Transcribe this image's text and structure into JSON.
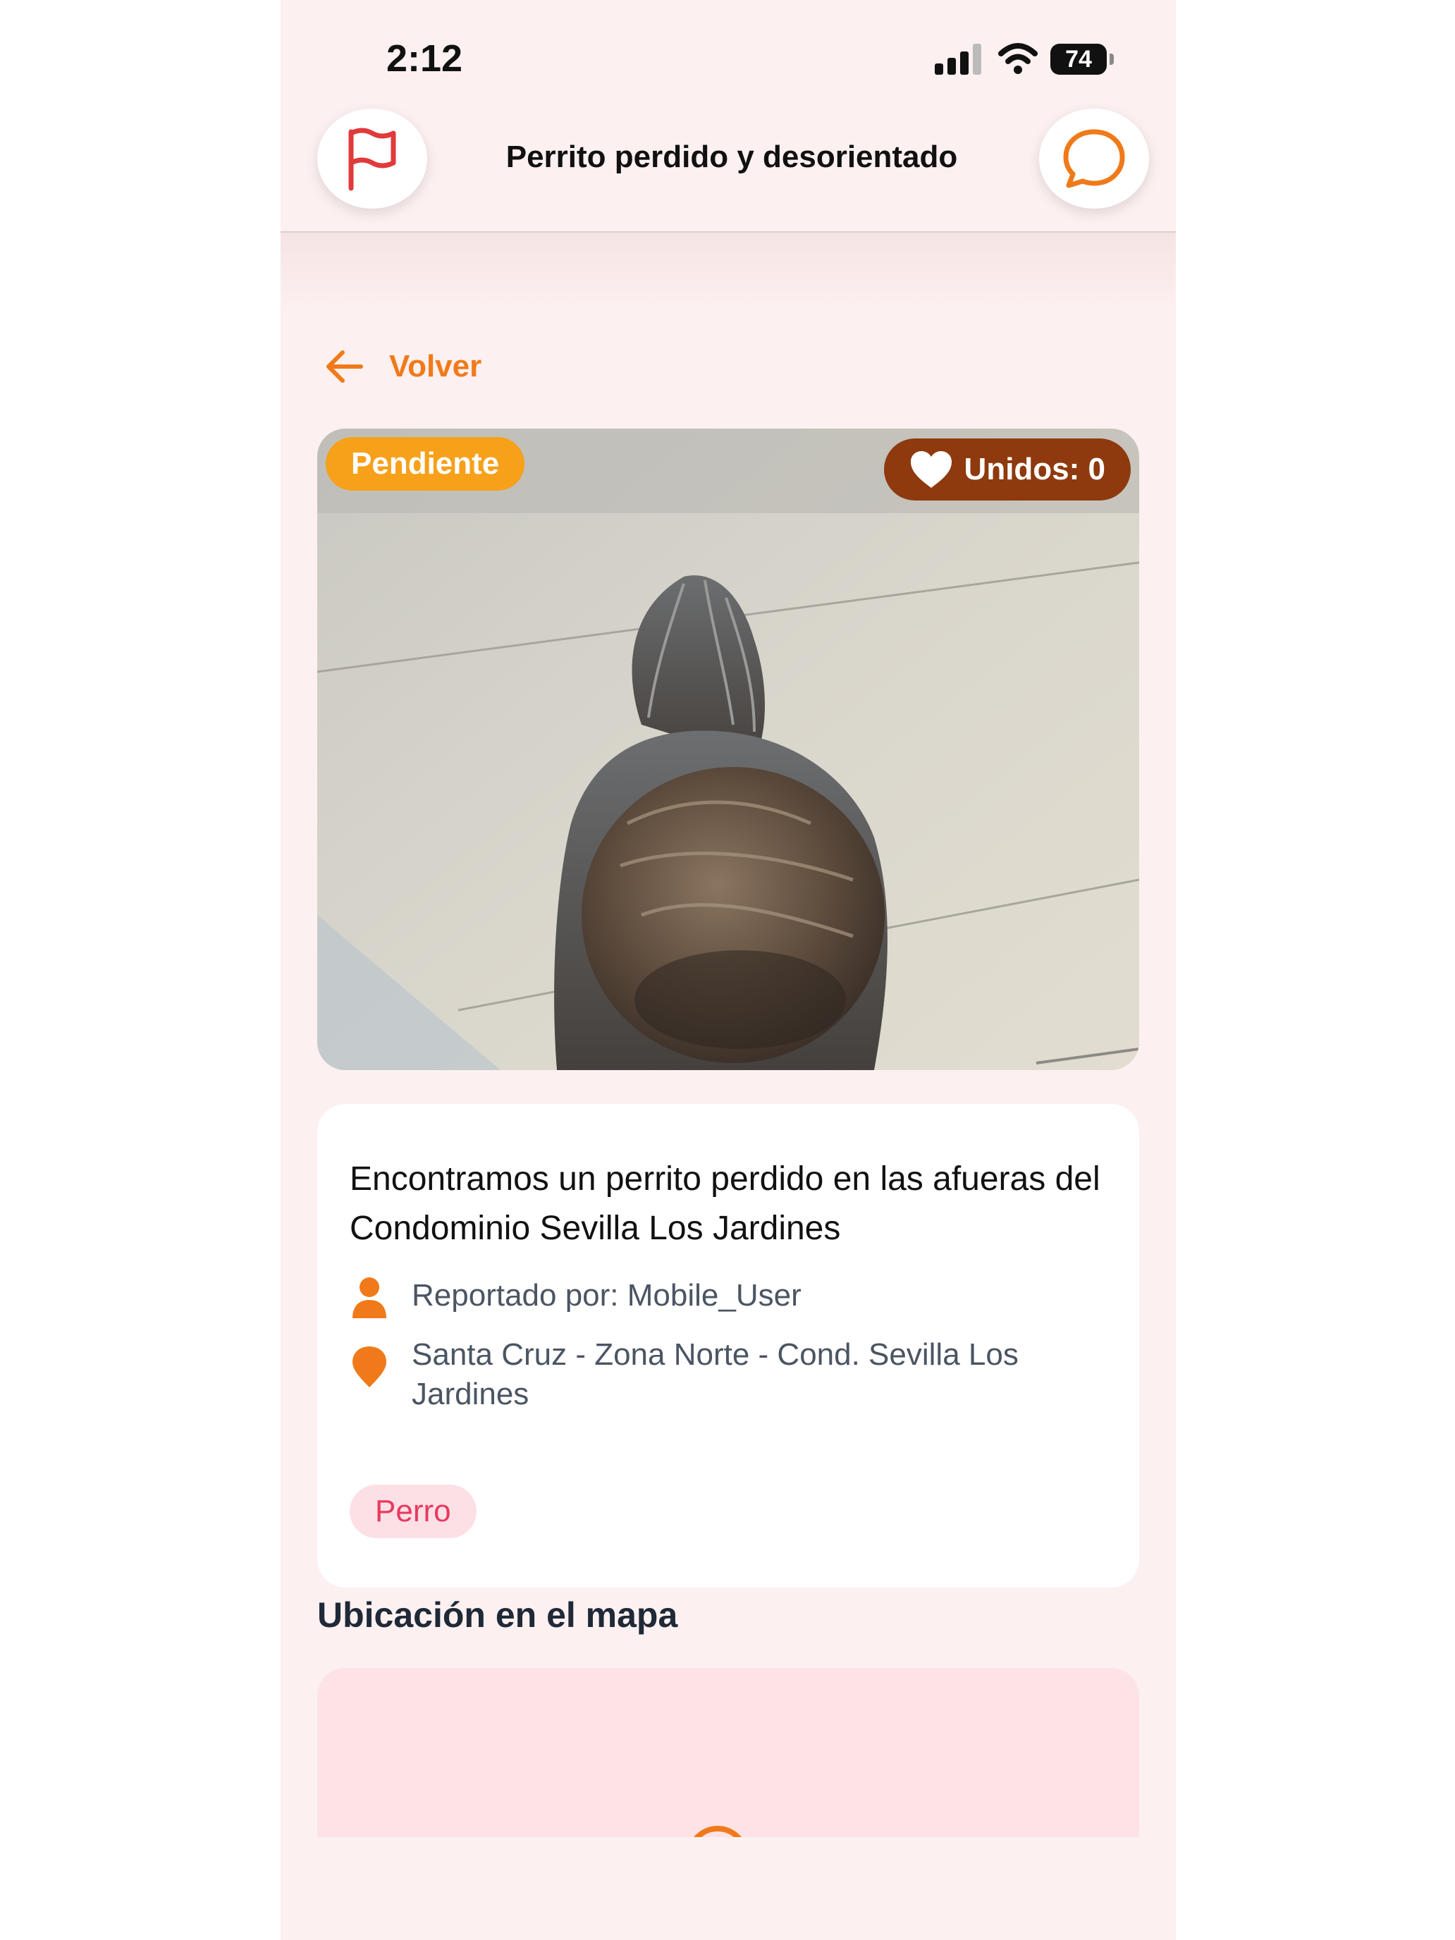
{
  "status_bar": {
    "time": "2:12",
    "battery": "74"
  },
  "header": {
    "title": "Perrito perdido y desorientado",
    "report_icon": "flag-icon",
    "chat_icon": "chat-bubble-icon"
  },
  "back": {
    "label": "Volver",
    "icon": "arrow-left-icon"
  },
  "post": {
    "status": "Pendiente",
    "joined_label": "Unidos: 0",
    "description": "Encontramos un perrito perdido en las afueras del Condominio Sevilla Los Jardines",
    "reporter": "Reportado por: Mobile_User",
    "location": "Santa Cruz - Zona Norte - Cond. Sevilla Los Jardines",
    "tag": "Perro"
  },
  "map": {
    "title": "Ubicación en el mapa"
  },
  "colors": {
    "accent": "#f07a1a",
    "status_badge": "#f7a01a",
    "joined_badge": "#8e3a0e",
    "tag_bg": "#fde0e6",
    "tag_text": "#e8395f",
    "report_flag": "#e03a3a",
    "background": "#fdf0f0"
  }
}
